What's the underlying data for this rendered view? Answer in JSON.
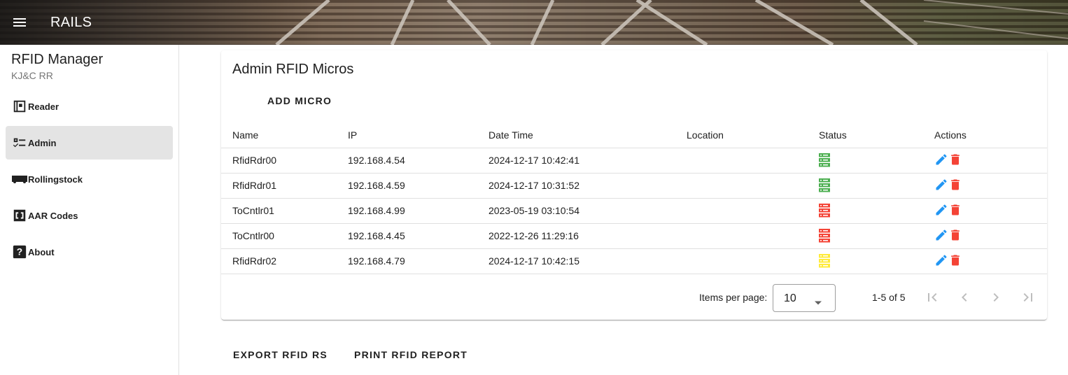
{
  "header": {
    "title": "RAILS",
    "menu_icon": "menu-icon"
  },
  "sidebar": {
    "title": "RFID Manager",
    "subtitle": "KJ&C RR",
    "items": [
      {
        "label": "Reader",
        "icon": "reader-icon"
      },
      {
        "label": "Admin",
        "icon": "admin-list-icon",
        "active": true
      },
      {
        "label": "Rollingstock",
        "icon": "train-car-icon"
      },
      {
        "label": "AAR Codes",
        "icon": "code-brackets-icon"
      },
      {
        "label": "About",
        "icon": "help-icon"
      }
    ]
  },
  "card": {
    "title": "Admin RFID Micros",
    "add_label": "ADD MICRO",
    "columns": [
      "Name",
      "IP",
      "Date Time",
      "Location",
      "Status",
      "Actions"
    ],
    "rows": [
      {
        "name": "RfidRdr00",
        "ip": "192.168.4.54",
        "datetime": "2024-12-17 10:42:41",
        "location": "",
        "status": "online"
      },
      {
        "name": "RfidRdr01",
        "ip": "192.168.4.59",
        "datetime": "2024-12-17 10:31:52",
        "location": "",
        "status": "online"
      },
      {
        "name": "ToCntlr01",
        "ip": "192.168.4.99",
        "datetime": "2023-05-19 03:10:54",
        "location": "",
        "status": "offline"
      },
      {
        "name": "ToCntlr00",
        "ip": "192.168.4.45",
        "datetime": "2022-12-26 11:29:16",
        "location": "",
        "status": "offline"
      },
      {
        "name": "RfidRdr02",
        "ip": "192.168.4.79",
        "datetime": "2024-12-17 10:42:15",
        "location": "",
        "status": "warning"
      }
    ],
    "paginator": {
      "items_per_page_label": "Items per page:",
      "items_per_page": "10",
      "range": "1-5 of 5"
    }
  },
  "footer_buttons": {
    "export": "EXPORT RFID RS",
    "print": "PRINT RFID REPORT"
  },
  "colors": {
    "online": "#4caf50",
    "offline": "#f44336",
    "warning": "#ffeb3b",
    "edit": "#2196f3",
    "delete": "#f44336"
  }
}
